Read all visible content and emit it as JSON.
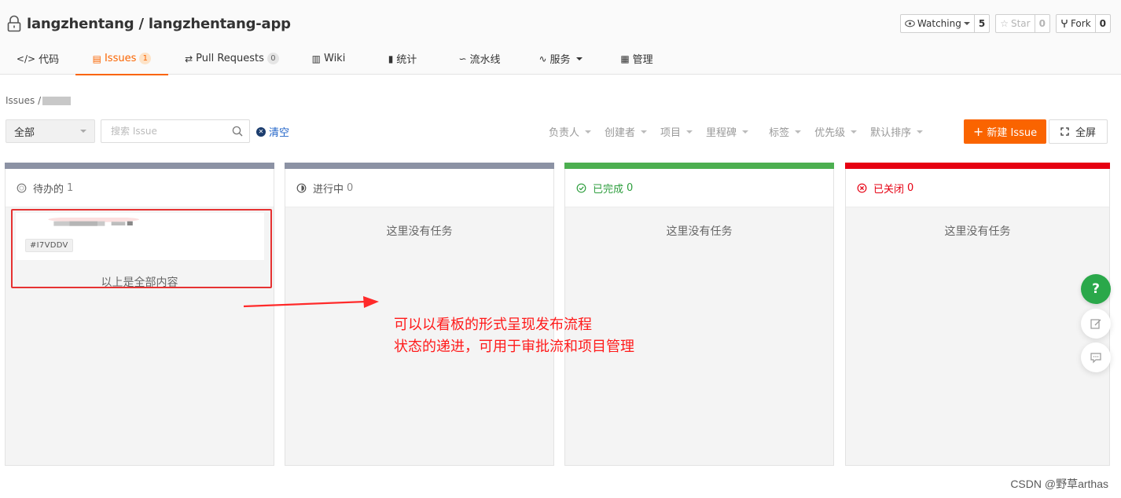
{
  "repo": {
    "path": "langzhentang / langzhentang-app",
    "watch_label": "Watching",
    "watch_count": "5",
    "star_label": "Star",
    "star_count": "0",
    "fork_label": "Fork",
    "fork_count": "0"
  },
  "tabs": [
    {
      "icon": "code-icon",
      "glyph": "</>",
      "label": "代码",
      "badge": ""
    },
    {
      "icon": "issues-icon",
      "glyph": "▤",
      "label": "Issues",
      "badge": "1"
    },
    {
      "icon": "pull-request-icon",
      "glyph": "⇄",
      "label": "Pull Requests",
      "badge": "0"
    },
    {
      "icon": "wiki-icon",
      "glyph": "▥",
      "label": "Wiki",
      "badge": ""
    },
    {
      "icon": "stats-icon",
      "glyph": "▮",
      "label": "统计",
      "badge": ""
    },
    {
      "icon": "pipeline-icon",
      "glyph": "∽",
      "label": "流水线",
      "badge": ""
    },
    {
      "icon": "service-icon",
      "glyph": "∿",
      "label": "服务",
      "badge": ""
    },
    {
      "icon": "manage-icon",
      "glyph": "▦",
      "label": "管理",
      "badge": ""
    }
  ],
  "breadcrumb": {
    "root": "Issues /"
  },
  "toolbar": {
    "scope_value": "全部",
    "search_placeholder": "搜索 Issue",
    "clear_label": "清空",
    "filters": [
      "负责人",
      "创建者",
      "项目",
      "里程碑",
      "标签",
      "优先级",
      "默认排序"
    ],
    "new_issue_label": "新建 Issue",
    "fullscreen_label": "全屏"
  },
  "columns": [
    {
      "title": "待办的",
      "count": "1",
      "color": "#8c92a4",
      "title_color": "#555555"
    },
    {
      "title": "进行中",
      "count": "0",
      "color": "#8c92a4",
      "title_color": "#555555"
    },
    {
      "title": "已完成",
      "count": "0",
      "color": "#4caf50",
      "title_color": "#2e9e3e"
    },
    {
      "title": "已关闭",
      "count": "0",
      "color": "#e60012",
      "title_color": "#e60012"
    }
  ],
  "card": {
    "issue_id": "#I7VDDV"
  },
  "empty_note": "这里没有任务",
  "all_loaded_note": "以上是全部内容",
  "annotation": {
    "line1": "可以以看板的形式呈现发布流程",
    "line2": "状态的递进，可用于审批流和项目管理"
  },
  "watermark": "CSDN @野草arthas",
  "colors": {
    "accent": "#fa6400",
    "help": "#2aa84a",
    "annotation": "#ff1a1a"
  }
}
